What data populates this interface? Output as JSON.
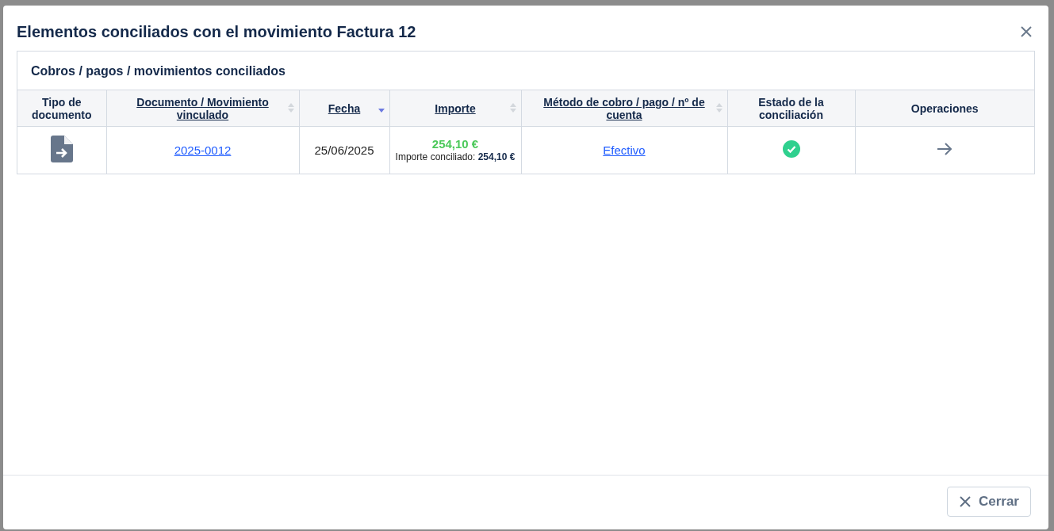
{
  "dialog": {
    "title": "Elementos conciliados con el movimiento Factura 12"
  },
  "panel": {
    "title": "Cobros / pagos / movimientos conciliados"
  },
  "table": {
    "columns": [
      {
        "label": "Tipo de documento",
        "sortable": false
      },
      {
        "label": "Documento / Movimiento vinculado",
        "sortable": true,
        "sorted": false
      },
      {
        "label": "Fecha",
        "sortable": true,
        "sorted": true
      },
      {
        "label": "Importe",
        "sortable": true,
        "sorted": false
      },
      {
        "label": "Método de cobro / pago / nº de cuenta",
        "sortable": true,
        "sorted": false
      },
      {
        "label": "Estado de la conciliación",
        "sortable": false
      },
      {
        "label": "Operaciones",
        "sortable": false
      }
    ],
    "rows": [
      {
        "document": "2025-0012",
        "date": "25/06/2025",
        "amount": "254,10 €",
        "reconciled_amount": "Importe conciliado: **254,10 €**",
        "method": "Efectivo",
        "reconciled": true
      }
    ]
  },
  "footer": {
    "close_button": "Cerrar"
  }
}
